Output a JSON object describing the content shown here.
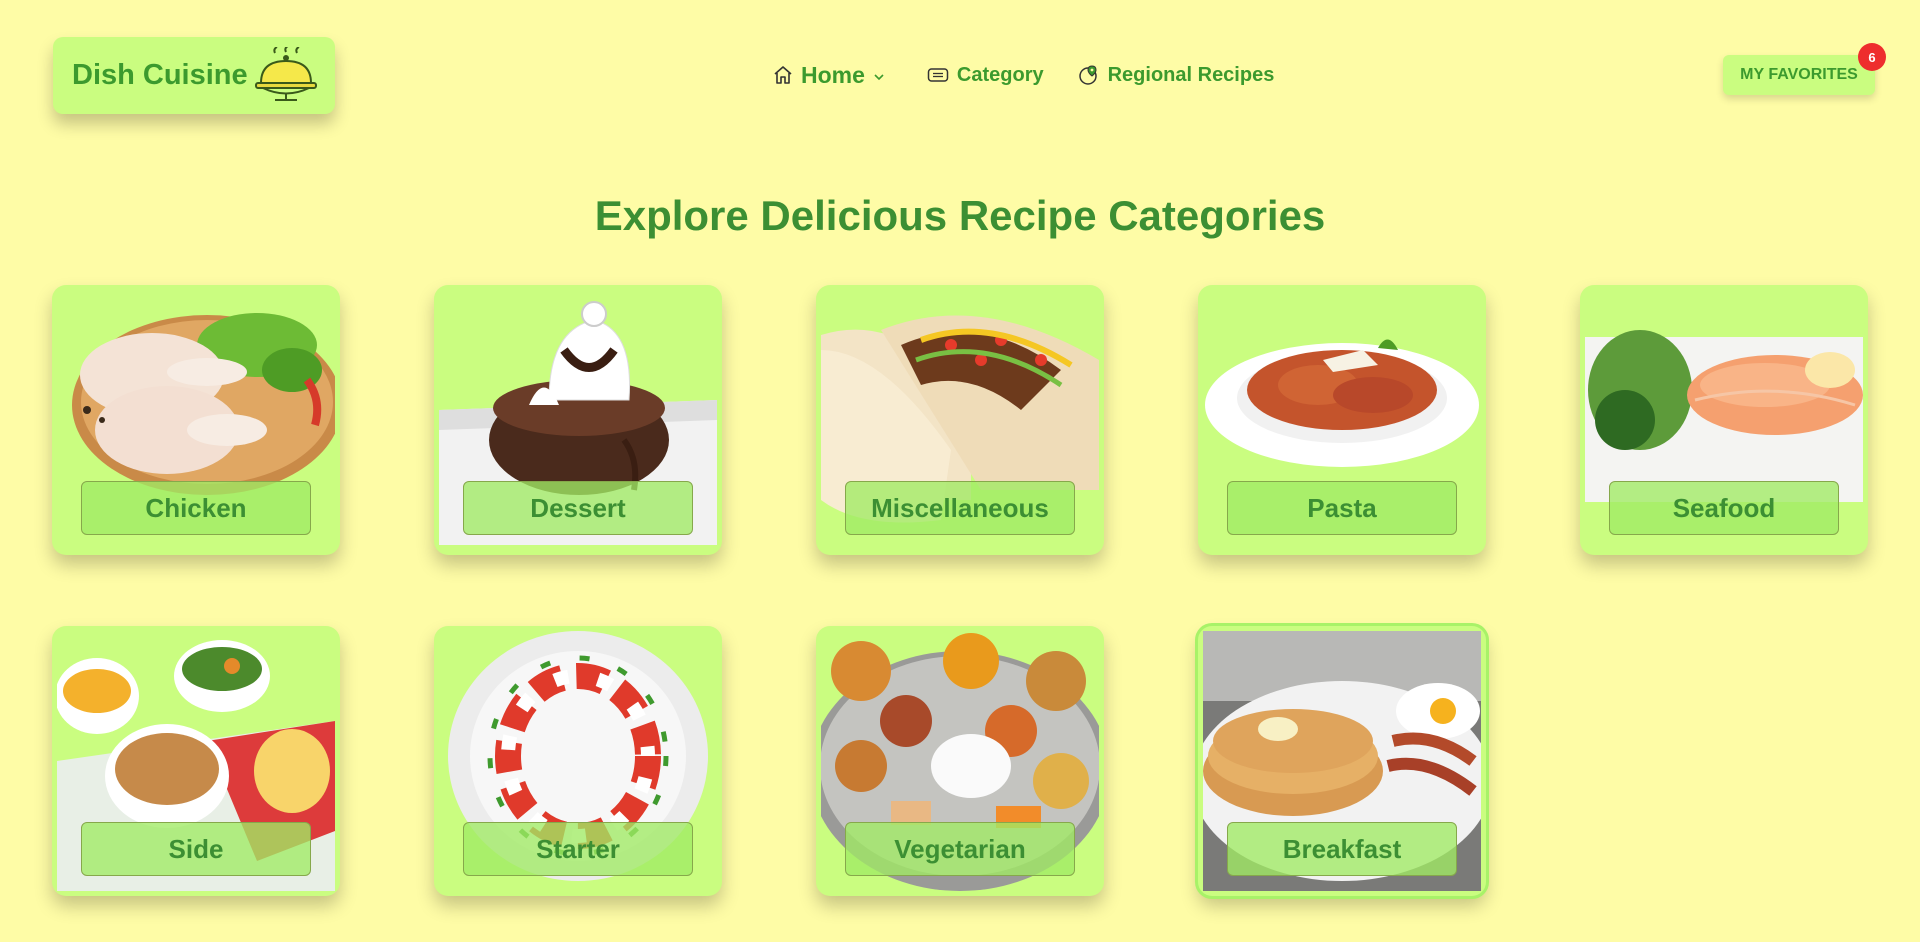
{
  "brand": {
    "name": "Dish Cuisine",
    "icon": "cloche-icon"
  },
  "nav": {
    "home": "Home",
    "category": "Category",
    "regional": "Regional Recipes"
  },
  "favorites": {
    "label": "MY FAVORITES",
    "count": "6"
  },
  "page_title": "Explore Delicious Recipe Categories",
  "categories": [
    {
      "label": "Chicken"
    },
    {
      "label": "Dessert"
    },
    {
      "label": "Miscellaneous"
    },
    {
      "label": "Pasta"
    },
    {
      "label": "Seafood"
    },
    {
      "label": "Side"
    },
    {
      "label": "Starter"
    },
    {
      "label": "Vegetarian"
    },
    {
      "label": "Breakfast"
    }
  ],
  "colors": {
    "background": "#fefca6",
    "card": "#cafd80",
    "accent_green": "#3c9a2e",
    "badge_red": "#ee2d2d"
  }
}
